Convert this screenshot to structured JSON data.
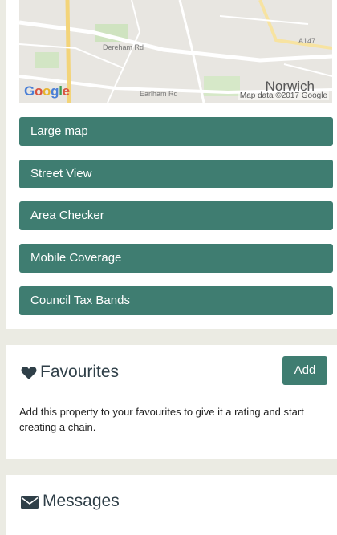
{
  "map": {
    "logo": [
      "G",
      "o",
      "o",
      "g",
      "l",
      "e"
    ],
    "credit": "Map data ©2017 Google",
    "labels": {
      "road1": "Dereham Rd",
      "road2": "Earlham Rd",
      "road3": "A147",
      "city": "Norwich"
    }
  },
  "actions": [
    {
      "label": "Large map"
    },
    {
      "label": "Street View"
    },
    {
      "label": "Area Checker"
    },
    {
      "label": "Mobile Coverage"
    },
    {
      "label": "Council Tax Bands"
    }
  ],
  "favourites": {
    "title": "Favourites",
    "add_label": "Add",
    "description": "Add this property to your favourites to give it a rating and start creating a chain."
  },
  "messages": {
    "title": "Messages"
  },
  "colors": {
    "accent": "#3f7d71",
    "heading": "#2f3f48",
    "background": "#ebebe3"
  },
  "icons": {
    "favourites": "heart-icon",
    "messages": "envelope-icon"
  }
}
